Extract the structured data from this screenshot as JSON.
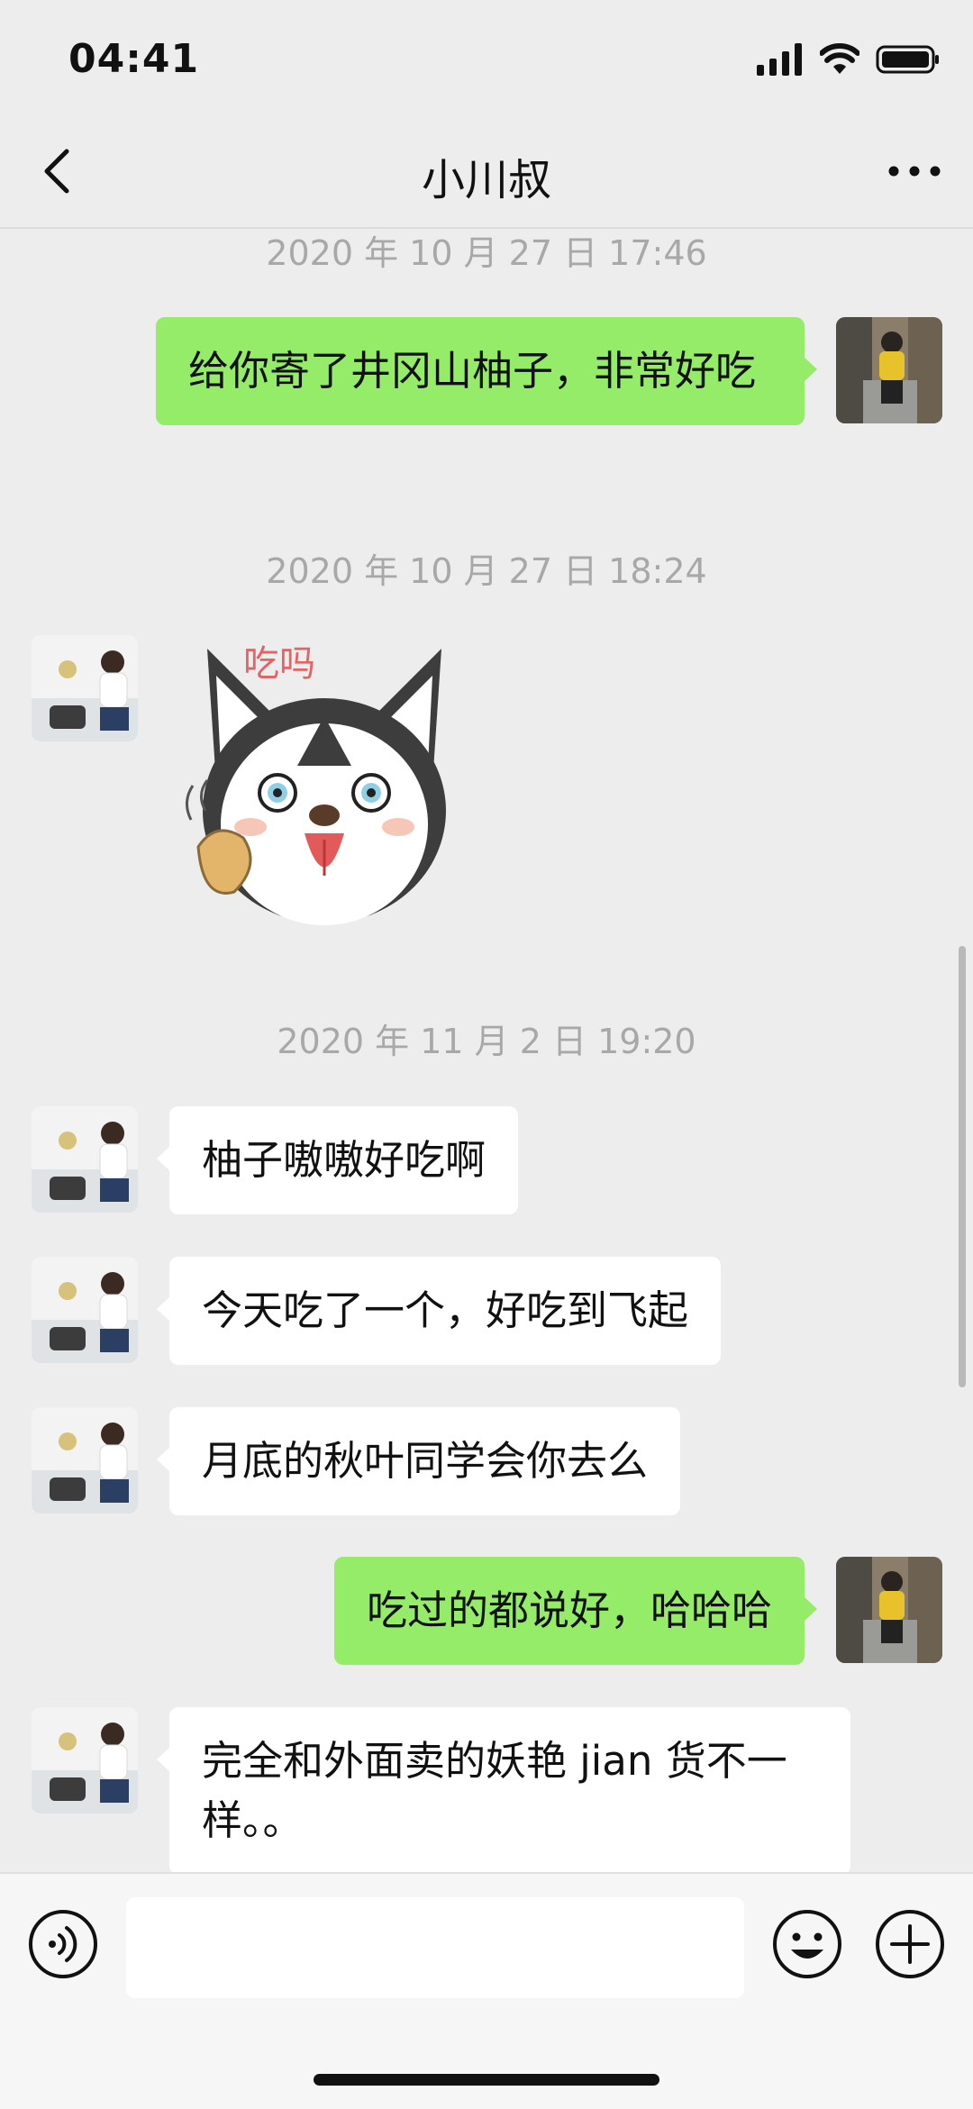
{
  "status_bar": {
    "time": "04:41"
  },
  "header": {
    "title": "小川叔"
  },
  "messages": [
    {
      "type": "timestamp",
      "text": "2020 年 10 月 27 日 17:46"
    },
    {
      "type": "text",
      "side": "out",
      "text": "给你寄了井冈山柚子，非常好吃"
    },
    {
      "type": "timestamp",
      "text": "2020 年 10 月 27 日 18:24"
    },
    {
      "type": "sticker",
      "side": "in",
      "text": "吃吗"
    },
    {
      "type": "timestamp",
      "text": "2020 年 11 月 2 日 19:20"
    },
    {
      "type": "text",
      "side": "in",
      "text": "柚子嗷嗷好吃啊"
    },
    {
      "type": "text",
      "side": "in",
      "text": "今天吃了一个，好吃到飞起"
    },
    {
      "type": "text",
      "side": "in",
      "text": "月底的秋叶同学会你去么"
    },
    {
      "type": "text",
      "side": "out",
      "text": "吃过的都说好，哈哈哈"
    },
    {
      "type": "text",
      "side": "in",
      "text": "完全和外面卖的妖艳 jian 货不一样。。"
    }
  ],
  "input_bar": {
    "value": "",
    "placeholder": ""
  },
  "icons": {
    "back": "chevron-left-icon",
    "more": "more-dots-icon",
    "voice": "voice-icon",
    "emoji": "emoji-icon",
    "plus": "plus-icon"
  },
  "colors": {
    "background": "#ededed",
    "outgoing_bubble": "#95ec69",
    "incoming_bubble": "#ffffff",
    "timestamp": "#a8a8a8"
  }
}
